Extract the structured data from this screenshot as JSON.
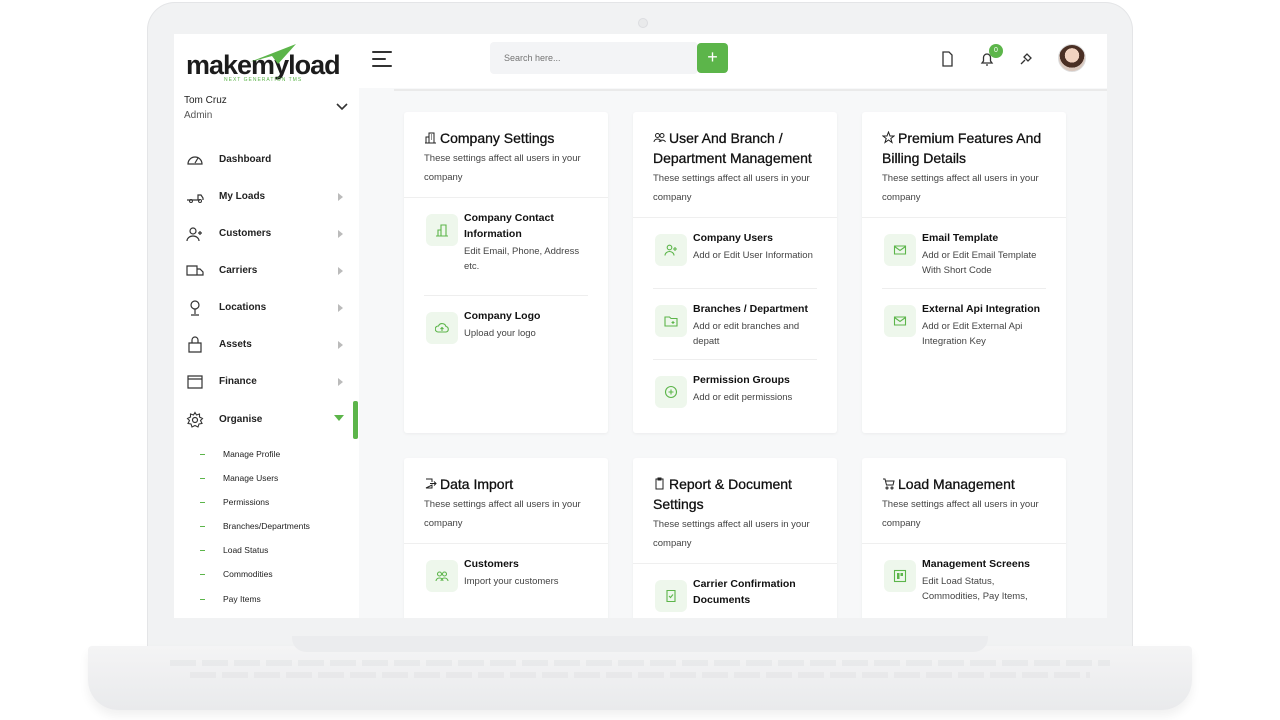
{
  "header": {
    "logo_text": "makemyload",
    "logo_tagline": "NEXT GENERATION TMS",
    "search_placeholder": "Search here...",
    "add_label": "+",
    "notification_count": "0"
  },
  "user": {
    "name": "Tom Cruz",
    "role": "Admin"
  },
  "sidebar": {
    "items": [
      {
        "label": "Dashboard"
      },
      {
        "label": "My Loads"
      },
      {
        "label": "Customers"
      },
      {
        "label": "Carriers"
      },
      {
        "label": "Locations"
      },
      {
        "label": "Assets"
      },
      {
        "label": "Finance"
      },
      {
        "label": "Organise"
      }
    ],
    "sub_items": [
      {
        "label": "Manage Profile"
      },
      {
        "label": "Manage Users"
      },
      {
        "label": "Permissions"
      },
      {
        "label": "Branches/Departments"
      },
      {
        "label": "Load Status"
      },
      {
        "label": "Commodities"
      },
      {
        "label": "Pay Items"
      }
    ]
  },
  "cards": [
    {
      "title": "Company Settings",
      "desc": "These settings affect all users in your company",
      "items": [
        {
          "title": "Company Contact Information",
          "desc": "Edit Email, Phone, Address etc."
        },
        {
          "title": "Company Logo",
          "desc": "Upload your logo"
        }
      ]
    },
    {
      "title": "User And Branch / Department Management",
      "desc": "These settings affect all users in your company",
      "items": [
        {
          "title": "Company Users",
          "desc": "Add or Edit User Information"
        },
        {
          "title": "Branches / Department",
          "desc": "Add or edit branches and depatt"
        },
        {
          "title": "Permission Groups",
          "desc": "Add or edit permissions"
        }
      ]
    },
    {
      "title": "Premium Features And Billing Details",
      "desc": "These settings affect all users in your company",
      "items": [
        {
          "title": "Email Template",
          "desc": "Add or Edit Email Template With Short Code"
        },
        {
          "title": "External Api Integration",
          "desc": "Add or Edit External Api Integration Key"
        }
      ]
    },
    {
      "title": "Data Import",
      "desc": "These settings affect all users in your company",
      "items": [
        {
          "title": "Customers",
          "desc": "Import your customers"
        }
      ]
    },
    {
      "title": "Report & Document Settings",
      "desc": "These settings affect all users in your company",
      "items": [
        {
          "title": "Carrier Confirmation Documents",
          "desc": ""
        }
      ]
    },
    {
      "title": "Load Management",
      "desc": "These settings affect all users in your company",
      "items": [
        {
          "title": "Management Screens",
          "desc": "Edit Load Status, Commodities, Pay Items,"
        }
      ]
    }
  ],
  "colors": {
    "accent": "#5cb54a",
    "item_icon_bg": "#eef7ec"
  }
}
